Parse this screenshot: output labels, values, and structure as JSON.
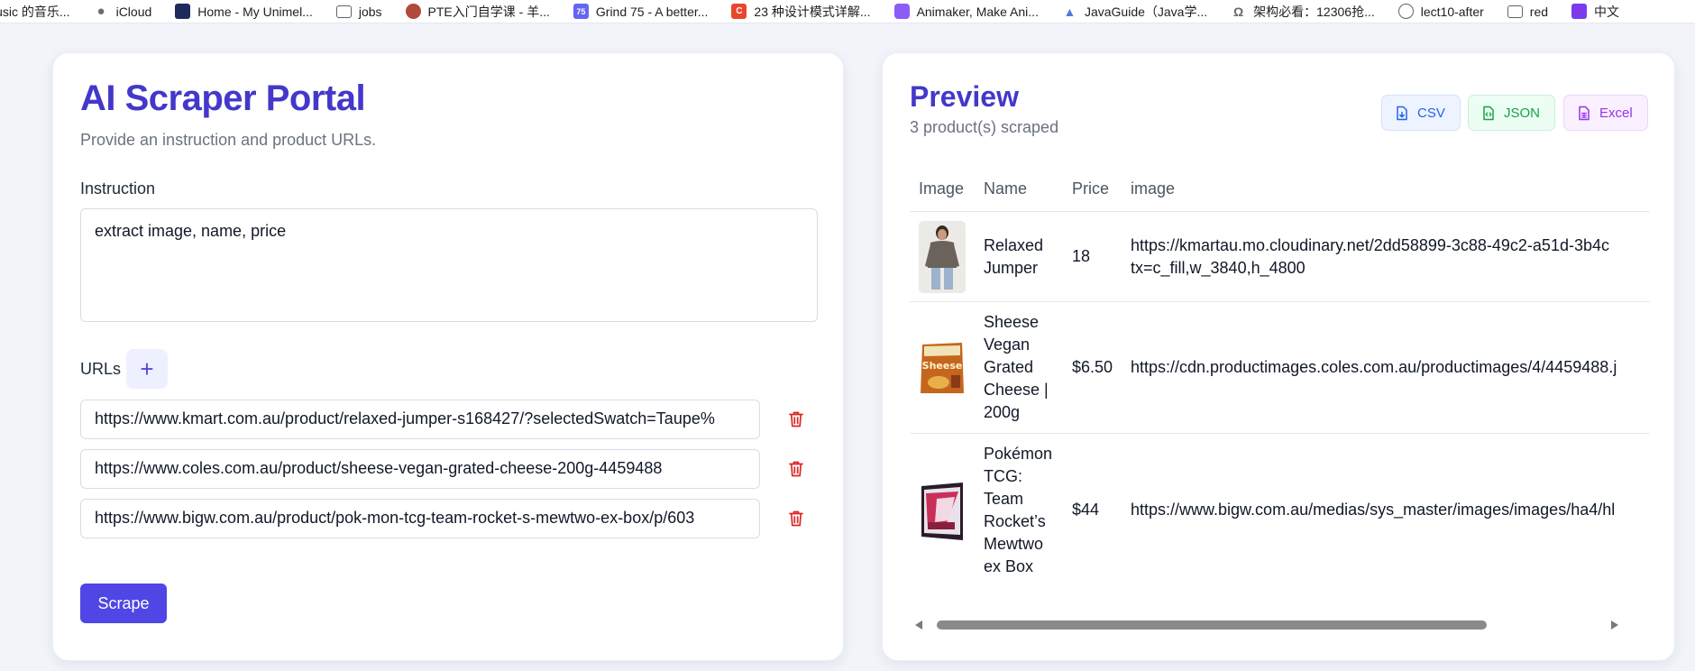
{
  "bookmarks": [
    {
      "label": "lusic 的音乐...",
      "icon": "none"
    },
    {
      "label": "iCloud",
      "icon": "apple-icon"
    },
    {
      "label": "Home - My Unimel...",
      "icon": "unimelb-icon"
    },
    {
      "label": "jobs",
      "icon": "folder-icon"
    },
    {
      "label": "PTE入门自学课 - 羊...",
      "icon": "avatar-icon"
    },
    {
      "label": "Grind 75 - A better...",
      "icon": "grind75-icon",
      "glyph": "75"
    },
    {
      "label": "23 种设计模式详解...",
      "icon": "c-icon",
      "glyph": "C"
    },
    {
      "label": "Animaker, Make Ani...",
      "icon": "animaker-icon"
    },
    {
      "label": "JavaGuide（Java学...",
      "icon": "javaguide-icon"
    },
    {
      "label": "架构必看：12306抢...",
      "icon": "architecture-icon"
    },
    {
      "label": "lect10-after",
      "icon": "globe-icon"
    },
    {
      "label": "red",
      "icon": "folder-icon"
    },
    {
      "label": "中文",
      "icon": "vv-icon"
    }
  ],
  "portal": {
    "title": "AI Scraper Portal",
    "subtitle": "Provide an instruction and product URLs.",
    "instruction_label": "Instruction",
    "instruction_value": "extract image, name, price",
    "urls_label": "URLs",
    "add_url_glyph": "+",
    "urls": [
      "https://www.kmart.com.au/product/relaxed-jumper-s168427/?selectedSwatch=Taupe%",
      "https://www.coles.com.au/product/sheese-vegan-grated-cheese-200g-4459488",
      "https://www.bigw.com.au/product/pok-mon-tcg-team-rocket-s-mewtwo-ex-box/p/603"
    ],
    "scrape_label": "Scrape"
  },
  "preview": {
    "title": "Preview",
    "count_text": "3 product(s) scraped",
    "export": {
      "csv": "CSV",
      "json": "JSON",
      "excel": "Excel"
    },
    "columns": [
      "Image",
      "Name",
      "Price",
      "image"
    ],
    "rows": [
      {
        "name": "Relaxed Jumper",
        "price": "18",
        "image_url_line1": "https://kmartau.mo.cloudinary.net/2dd58899-3c88-49c2-a51d-3b4c",
        "image_url_line2": "tx=c_fill,w_3840,h_4800"
      },
      {
        "name": "Sheese Vegan Grated Cheese | 200g",
        "price": "$6.50",
        "image_url_line1": "https://cdn.productimages.coles.com.au/productimages/4/4459488.j",
        "image_url_line2": ""
      },
      {
        "name": "Pokémon TCG: Team Rocket’s Mewtwo ex Box",
        "price": "$44",
        "image_url_line1": "https://www.bigw.com.au/medias/sys_master/images/images/ha4/hl",
        "image_url_line2": ""
      }
    ]
  },
  "colors": {
    "accent": "#4f46e5",
    "title": "#4338ca",
    "danger": "#dc2626",
    "csv": "#2563eb",
    "json": "#16a34a",
    "excel": "#9333ea"
  }
}
